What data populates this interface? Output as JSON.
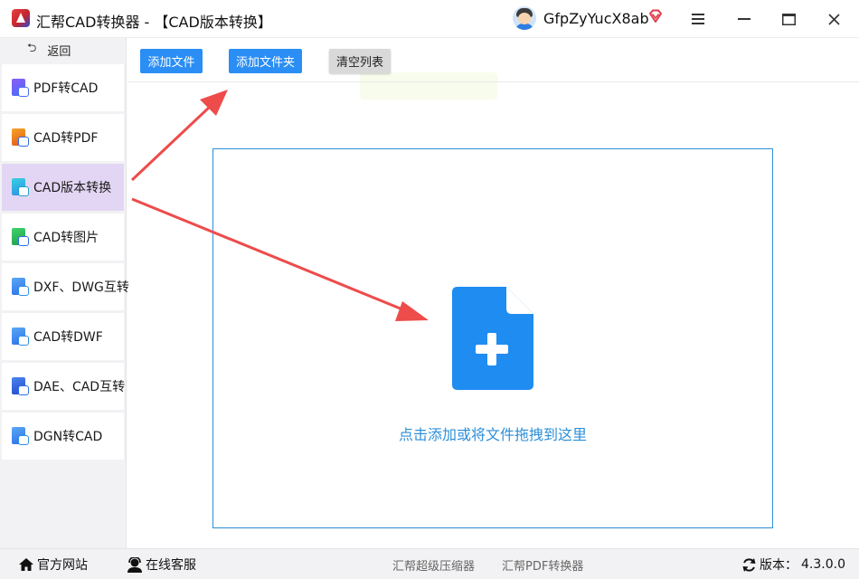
{
  "window": {
    "title": "汇帮CAD转换器 - 【CAD版本转换】",
    "username": "GfpZyYucX8ab",
    "icons": [
      "app-logo-icon",
      "avatar",
      "vip-diamond-icon",
      "menu-icon",
      "minimize-icon",
      "maximize-icon",
      "close-icon"
    ]
  },
  "sidebar": {
    "back_label": "返回",
    "items": [
      {
        "label": "PDF转CAD",
        "icon": "pdf-to-cad-icon",
        "color": "#4a6cf7",
        "active": false
      },
      {
        "label": "CAD转PDF",
        "icon": "cad-to-pdf-icon",
        "color": "#f08a1c",
        "active": false
      },
      {
        "label": "CAD版本转换",
        "icon": "cad-version-icon",
        "color": "#2bb7d9",
        "active": true
      },
      {
        "label": "CAD转图片",
        "icon": "cad-to-image-icon",
        "color": "#2fbf5a",
        "active": false
      },
      {
        "label": "DXF、DWG互转",
        "icon": "dxf-dwg-icon",
        "color": "#2d8fe8",
        "active": false
      },
      {
        "label": "CAD转DWF",
        "icon": "cad-to-dwf-icon",
        "color": "#2d8fe8",
        "active": false
      },
      {
        "label": "DAE、CAD互转",
        "icon": "dae-cad-icon",
        "color": "#2d6fe8",
        "active": false
      },
      {
        "label": "DGN转CAD",
        "icon": "dgn-to-cad-icon",
        "color": "#2d8fe8",
        "active": false
      }
    ]
  },
  "toolbar": {
    "add_file": "添加文件",
    "add_folder": "添加文件夹",
    "clear_list": "清空列表"
  },
  "dropzone": {
    "hint": "点击添加或将文件拖拽到这里",
    "accent": "#2d8fd9"
  },
  "footer": {
    "website": "官方网站",
    "support": "在线客服",
    "app_compressor": "汇帮超级压缩器",
    "app_pdf": "汇帮PDF转换器",
    "version_label": "版本：",
    "version": "4.3.0.0"
  },
  "colors": {
    "primary": "#2a8ef5",
    "active_nav": "#e3d6f4",
    "annotation_arrow": "#ee4b4b"
  }
}
